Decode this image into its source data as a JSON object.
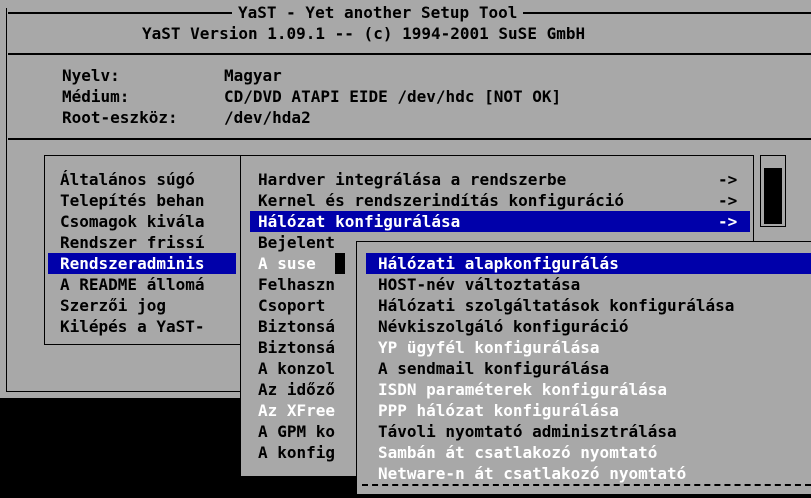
{
  "header": {
    "title": "YaST - Yet another Setup Tool",
    "version": "YaST Version 1.09.1 -- (c) 1994-2001 SuSE GmbH"
  },
  "info": [
    {
      "label": "Nyelv:",
      "value": "Magyar"
    },
    {
      "label": "Médium:",
      "value": "CD/DVD ATAPI EIDE /dev/hdc [NOT OK]"
    },
    {
      "label": "Root-eszköz:",
      "value": "/dev/hda2"
    }
  ],
  "main_menu": [
    {
      "label": "Általános súgó"
    },
    {
      "label": "Telepítés behan"
    },
    {
      "label": "Csomagok kivála"
    },
    {
      "label": "Rendszer frissí"
    },
    {
      "label": "Rendszeradminis"
    },
    {
      "label": "A README állomá"
    },
    {
      "label": "Szerzői jog"
    },
    {
      "label": "Kilépés a YaST-"
    }
  ],
  "admin_menu": [
    {
      "label": "Hardver integrálása a rendszerbe",
      "arrow": "->"
    },
    {
      "label": "Kernel és rendszerindítás konfiguráció",
      "arrow": "->"
    },
    {
      "label": "Hálózat konfigurálása",
      "arrow": "->"
    },
    {
      "label": "Bejelent",
      "arrow": ""
    },
    {
      "label": "A suse",
      "arrow": ""
    },
    {
      "label": "Felhaszn",
      "arrow": ""
    },
    {
      "label": "Csoport",
      "arrow": ""
    },
    {
      "label": "Biztonsá",
      "arrow": ""
    },
    {
      "label": "Biztonsá",
      "arrow": ""
    },
    {
      "label": "A konzol",
      "arrow": ""
    },
    {
      "label": "Az időző",
      "arrow": ""
    },
    {
      "label": "Az XFree",
      "arrow": ""
    },
    {
      "label": "A GPM ko",
      "arrow": ""
    },
    {
      "label": "A konfig",
      "arrow": ""
    }
  ],
  "network_menu": [
    {
      "label": "Hálózati alapkonfigurálás"
    },
    {
      "label": "HOST-név változtatása"
    },
    {
      "label": "Hálózati szolgáltatások konfigurálása"
    },
    {
      "label": "Névkiszolgáló konfiguráció"
    },
    {
      "label": "YP ügyfél konfigurálása"
    },
    {
      "label": "A sendmail konfigurálása"
    },
    {
      "label": "ISDN paraméterek konfigurálása"
    },
    {
      "label": "PPP hálózat konfigurálása"
    },
    {
      "label": "Távoli nyomtató adminisztrálása"
    },
    {
      "label": "Sambán át csatlakozó nyomtató"
    },
    {
      "label": "Netware-n át csatlakozó nyomtató"
    }
  ],
  "colors": {
    "panel": "#a8a8a8",
    "selection": "#0000aa",
    "disabled_text": "#ffffff",
    "text": "#000000"
  }
}
